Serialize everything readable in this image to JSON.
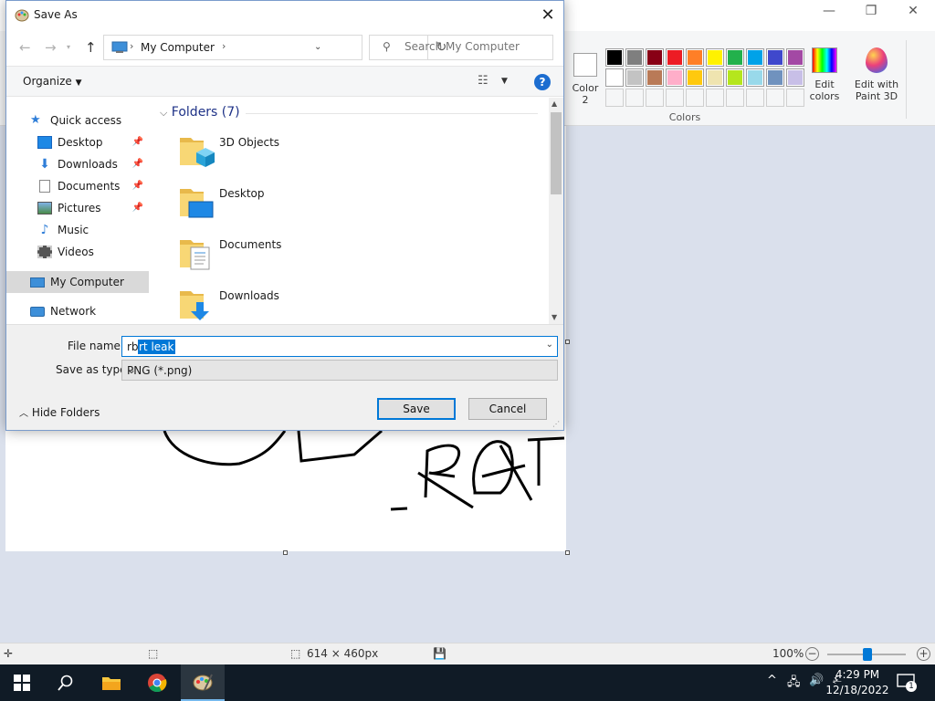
{
  "paint": {
    "color2_label": "Color\n2",
    "colors_group_label": "Colors",
    "edit_colors_label": "Edit colors",
    "edit_paint3d_label": "Edit with Paint 3D",
    "palette_row1": [
      "#000000",
      "#7f7f7f",
      "#880015",
      "#ed1c24",
      "#ff7f27",
      "#fff200",
      "#22b14c",
      "#00a2e8",
      "#3f48cc",
      "#a349a4"
    ],
    "palette_row2": [
      "#ffffff",
      "#c3c3c3",
      "#b97a57",
      "#ffaec9",
      "#ffc90e",
      "#efe4b0",
      "#b5e61d",
      "#99d9ea",
      "#7092be",
      "#c8bfe7"
    ],
    "status": {
      "canvas_size": "614 × 460px",
      "zoom": "100%"
    }
  },
  "dialog": {
    "title": "Save As",
    "address": "My Computer",
    "search_placeholder": "Search My Computer",
    "organize_label": "Organize",
    "nav": {
      "quick_access": "Quick access",
      "items": [
        "Desktop",
        "Downloads",
        "Documents",
        "Pictures",
        "Music",
        "Videos"
      ],
      "my_computer": "My Computer",
      "network": "Network"
    },
    "folders_header": "Folders (7)",
    "folders": [
      "3D Objects",
      "Desktop",
      "Documents",
      "Downloads"
    ],
    "file_name_label": "File name:",
    "file_name_unselected": "rb",
    "file_name_selected": "rt leak",
    "save_type_label": "Save as type:",
    "save_type_value": "PNG (*.png)",
    "hide_folders_label": "Hide Folders",
    "save_button": "Save",
    "cancel_button": "Cancel"
  },
  "taskbar": {
    "time": "4:29 PM",
    "date": "12/18/2022",
    "notification_count": "1"
  },
  "colors": {
    "accent": "#0078d7",
    "taskbar": "#101b26",
    "folder_yellow": "#f8d775"
  }
}
